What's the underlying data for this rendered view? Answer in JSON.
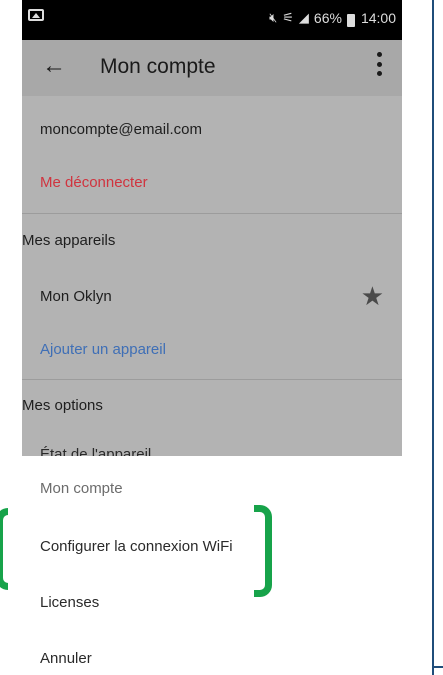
{
  "status_bar": {
    "battery": "66%",
    "time": "14:00",
    "icons": [
      "image-icon",
      "mute-icon",
      "wifi-icon",
      "signal-icon",
      "battery-icon"
    ]
  },
  "app_bar": {
    "title": "Mon compte",
    "back_icon": "arrow-left-icon",
    "more_icon": "more-vertical-icon"
  },
  "account": {
    "email": "moncompte@email.com",
    "logout_label": "Me déconnecter"
  },
  "devices": {
    "section_title": "Mes appareils",
    "items": [
      {
        "name": "Mon Oklyn",
        "favorite": true
      }
    ],
    "add_label": "Ajouter un appareil"
  },
  "options": {
    "section_title": "Mes options",
    "partial_text": "État de l'appareil..."
  },
  "sheet": {
    "header": "Mon compte",
    "items": [
      "Configurer la connexion WiFi",
      "Licenses",
      "Annuler"
    ]
  },
  "colors": {
    "logout": "#d0343f",
    "link": "#3f6fb6",
    "highlight_bracket": "#17a34a",
    "overlay_background": "#b3b3b3"
  }
}
